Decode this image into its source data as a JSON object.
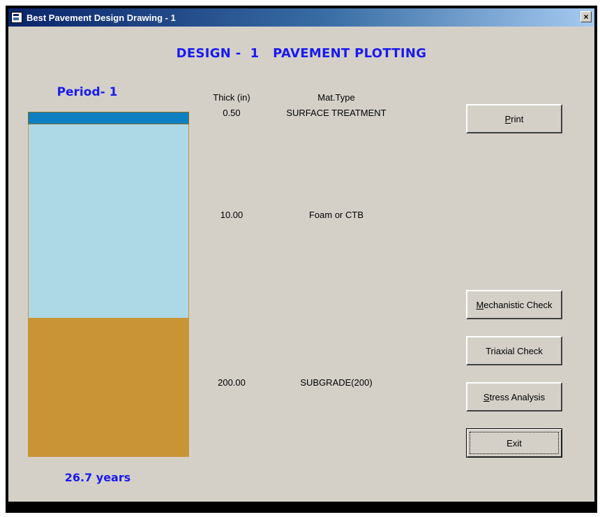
{
  "window": {
    "title": "Best Pavement Design Drawing - 1",
    "close_label": "×"
  },
  "design_title": "DESIGN -  1   PAVEMENT PLOTTING",
  "period_label": "Period- 1",
  "years_label": "26.7  years",
  "table": {
    "headers": {
      "thickness": "Thick (in)",
      "material": "Mat.Type"
    },
    "rows": [
      {
        "thickness": "0.50",
        "material": "SURFACE TREATMENT"
      },
      {
        "thickness": "10.00",
        "material": "Foam or CTB"
      },
      {
        "thickness": "200.00",
        "material": "SUBGRADE(200)"
      }
    ]
  },
  "layers": [
    {
      "name": "SURFACE TREATMENT",
      "color": "#0e7fc0"
    },
    {
      "name": "Foam or CTB",
      "color": "#add8e6"
    },
    {
      "name": "SUBGRADE(200)",
      "color": "#c99436"
    }
  ],
  "buttons": {
    "print": {
      "mnemonic": "P",
      "rest": "rint"
    },
    "mechanistic": {
      "mnemonic": "M",
      "rest": "echanistic Check"
    },
    "triaxial": {
      "label": "Triaxial Check"
    },
    "stress": {
      "mnemonic": "S",
      "rest": "tress Analysis"
    },
    "exit": {
      "label": "Exit"
    }
  },
  "colors": {
    "accent_text": "#1a1aee",
    "dialog_bg": "#d4d0c8",
    "titlebar": "#0a246a"
  }
}
